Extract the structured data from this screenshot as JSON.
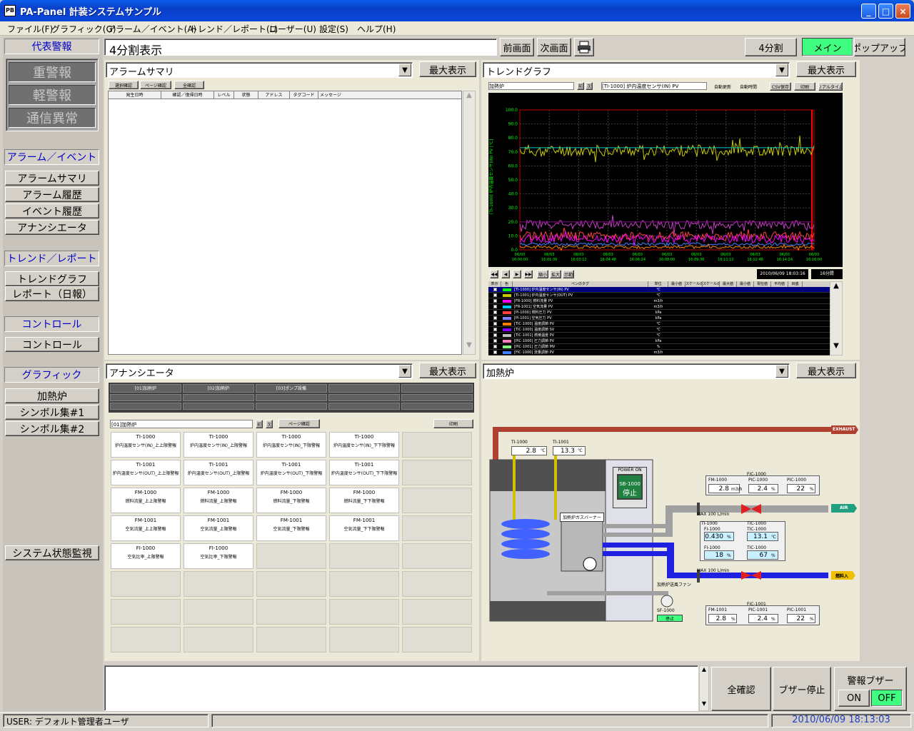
{
  "window": {
    "title": "PA-Panel 計装システムサンプル",
    "min": "_",
    "max": "□",
    "close": "×"
  },
  "menu": [
    "ファイル(F)",
    "グラフィック(G)",
    "アラーム／イベント(A)",
    "トレンド／レポート(L)",
    "ユーザー(U)",
    "設定(S)",
    "ヘルプ(H)"
  ],
  "sidebar": {
    "rep_alarm_head": "代表警報",
    "rep_alarms": [
      "重警報",
      "軽警報",
      "通信異常"
    ],
    "alarm_event_head": "アラーム／イベント",
    "alarm_event_items": [
      "アラームサマリ",
      "アラーム履歴",
      "イベント履歴",
      "アナンシエータ"
    ],
    "trend_head": "トレンド／レポート",
    "trend_items": [
      "トレンドグラフ",
      "レポート（日報）"
    ],
    "control_head": "コントロール",
    "control_items": [
      "コントロール"
    ],
    "graphic_head": "グラフィック",
    "graphic_items": [
      "加熱炉",
      "シンボル集#1",
      "シンボル集#2"
    ],
    "system_monitor": "システム状態監視"
  },
  "toolbar": {
    "title": "4分割表示",
    "prev": "前画面",
    "next": "次画面",
    "split": "4分割",
    "main": "メイン",
    "popup": "ポップアップ",
    "maximize": "最大表示"
  },
  "panes": {
    "alarm_summary": {
      "combo": "アラームサマリ",
      "buttons": [
        "選択確認",
        "ページ確認",
        "全確認"
      ],
      "headers": [
        "発生日時",
        "確認／復帰日時",
        "レベル",
        "状態",
        "アドレス",
        "タグコード",
        "メッセージ"
      ]
    },
    "trend": {
      "combo": "トレンドグラフ",
      "group": "加熱炉",
      "tag": "[TI-1000] 炉内温度センサ(IN) PV",
      "checks": [
        "自動更新",
        "自動時間"
      ],
      "buttons": [
        "CSV保存",
        "印刷",
        "リアルタイム"
      ],
      "y_ticks": [
        "100.0",
        "90.0",
        "80.0",
        "70.0",
        "60.0",
        "50.0",
        "40.0",
        "30.0",
        "20.0",
        "10.0",
        "0.0"
      ],
      "y_label": "[TI-1000] 炉内温度センサ(IN) PV [℃]",
      "x_ticks": [
        "06/03 16:00:00",
        "06/03 16:01:36",
        "06/03 16:03:12",
        "06/03 16:04:48",
        "06/03 16:06:24",
        "06/03 16:08:00",
        "06/03 16:09:36",
        "06/03 16:11:12",
        "06/03 16:12:48",
        "06/03 16:14:24",
        "06/03 16:16:00"
      ],
      "datetime": "2010/06/09 18:03:16",
      "range": "16分間",
      "nav_labels": [
        "縮小",
        "拡大",
        "表示範囲"
      ],
      "table_headers": [
        "表示",
        "色",
        "ペンのタグ",
        "単位",
        "最小値",
        "スケール(L)",
        "スケール(H)",
        "最大値",
        "最小値",
        "現在値",
        "平均値",
        "目盛"
      ],
      "table_rows": [
        {
          "name": "[TI-1000] 炉内温度センサ(IN) PV",
          "unit": "℃",
          "color": "#00ff00"
        },
        {
          "name": "[TI-1001] 炉内温度センサ(OUT) PV",
          "unit": "℃",
          "color": "#c8c800"
        },
        {
          "name": "[FR-1000] 燃料流量 PV",
          "unit": "m3/h",
          "color": "#ff00ff"
        },
        {
          "name": "[FR-1001] 空気流量 PV",
          "unit": "m3/h",
          "color": "#00c8ff"
        },
        {
          "name": "[PI-1000] 燃料圧力 PV",
          "unit": "kPa",
          "color": "#ff4040"
        },
        {
          "name": "[PI-1001] 空気圧力 PV",
          "unit": "kPa",
          "color": "#8080ff"
        },
        {
          "name": "[TIC-1000] 温度調節 PV",
          "unit": "℃",
          "color": "#ff8000"
        },
        {
          "name": "[TIC-1000] 温度調節 SV",
          "unit": "℃",
          "color": "#8000ff"
        },
        {
          "name": "[TIC-1001] 燃焼温度 PV",
          "unit": "℃",
          "color": "#c0c0c0"
        },
        {
          "name": "[PIC-1000] 圧力調節 PV",
          "unit": "kPa",
          "color": "#ff80c0"
        },
        {
          "name": "[PIC-1001] 圧力調節 MV",
          "unit": "%",
          "color": "#80ff80"
        },
        {
          "name": "[FIC-1000] 流量調節 PV",
          "unit": "m3/h",
          "color": "#4080ff"
        }
      ]
    },
    "annunciator": {
      "combo": "アナンシエータ",
      "tabs": [
        "[01]加熱炉",
        "[02]加熱炉",
        "[03]ポンプ設備",
        "",
        ""
      ],
      "group": "[01]加熱炉",
      "page_confirm": "ページ確認",
      "print": "印刷",
      "cells": [
        [
          "TI-1000",
          "炉内温度センサ(IN)_上上限警報"
        ],
        [
          "TI-1000",
          "炉内温度センサ(IN)_上限警報"
        ],
        [
          "TI-1000",
          "炉内温度センサ(IN)_下限警報"
        ],
        [
          "TI-1000",
          "炉内温度センサ(IN)_下下限警報"
        ],
        [
          "TI-1001",
          "炉内温度センサ(OUT)_上上限警報"
        ],
        [
          "TI-1001",
          "炉内温度センサ(OUT)_上限警報"
        ],
        [
          "TI-1001",
          "炉内温度センサ(OUT)_下限警報"
        ],
        [
          "TI-1001",
          "炉内温度センサ(OUT)_下下限警報"
        ],
        [
          "FM-1000",
          "燃料流量_上上限警報"
        ],
        [
          "FM-1000",
          "燃料流量_上限警報"
        ],
        [
          "FM-1000",
          "燃料流量_下限警報"
        ],
        [
          "FM-1000",
          "燃料流量_下下限警報"
        ],
        [
          "FM-1001",
          "空気流量_上上限警報"
        ],
        [
          "FM-1001",
          "空気流量_上限警報"
        ],
        [
          "FM-1001",
          "空気流量_下限警報"
        ],
        [
          "FM-1001",
          "空気流量_下下限警報"
        ],
        [
          "FI-1000",
          "空気比率_上限警報"
        ],
        [
          "FI-1000",
          "空気比率_下限警報"
        ]
      ]
    },
    "heater": {
      "combo": "加熱炉",
      "exhaust": "EXHAUST",
      "air": "AIR",
      "fuel": "燃料入",
      "burner": "加熱炉ガスバーナー",
      "fan": "加熱炉送風ファン",
      "power": "POWER ON",
      "sb1000": "SB-1000",
      "sb1000_state": "停止",
      "sf1000": "SF-1000",
      "sf1000_state": "停止",
      "ti1000": {
        "tag": "TI-1000",
        "val": "2.8",
        "unit": "℃"
      },
      "ti1001": {
        "tag": "TI-1001",
        "val": "13.3",
        "unit": "℃"
      },
      "fm1000": {
        "tag": "FM-1000",
        "val": "2.8",
        "unit": "m3/h"
      },
      "fi1000": {
        "tag": "FI-1000",
        "val": "0.430",
        "unit": "%"
      },
      "fi1000b": {
        "tag": "FI-1000",
        "val": "18",
        "unit": "%"
      },
      "pic1000": {
        "tag": "PIC-1000",
        "pv": "2.4",
        "mv": "22",
        "unit1": "%",
        "unit2": "%"
      },
      "tic1000": {
        "tag": "TIC-1000",
        "val": "13.1",
        "unit": "℃"
      },
      "tic1000b": {
        "tag": "TIC-1000",
        "val": "67",
        "unit": "%"
      },
      "fm1001": {
        "tag": "FM-1001",
        "val": "2.8",
        "unit": "%"
      },
      "pic1001": {
        "tag": "PIC-1001",
        "pv": "2.4",
        "mv": "22",
        "unit1": "%",
        "unit2": "%"
      },
      "fic1000": "FIC-1000",
      "ti1000_lbl": "TI-1000",
      "fic1001": "FIC-1001",
      "max1": "MAX 100 L/min",
      "max2": "MAX 100 L/min"
    }
  },
  "bottom": {
    "ack_all": "全確認",
    "buzzer_stop": "ブザー停止",
    "alarm_buzzer": "警報ブザー",
    "on": "ON",
    "off": "OFF"
  },
  "status": {
    "user": "USER: デフォルト管理者ユーザ",
    "datetime": "2010/06/09 18:13:03"
  }
}
